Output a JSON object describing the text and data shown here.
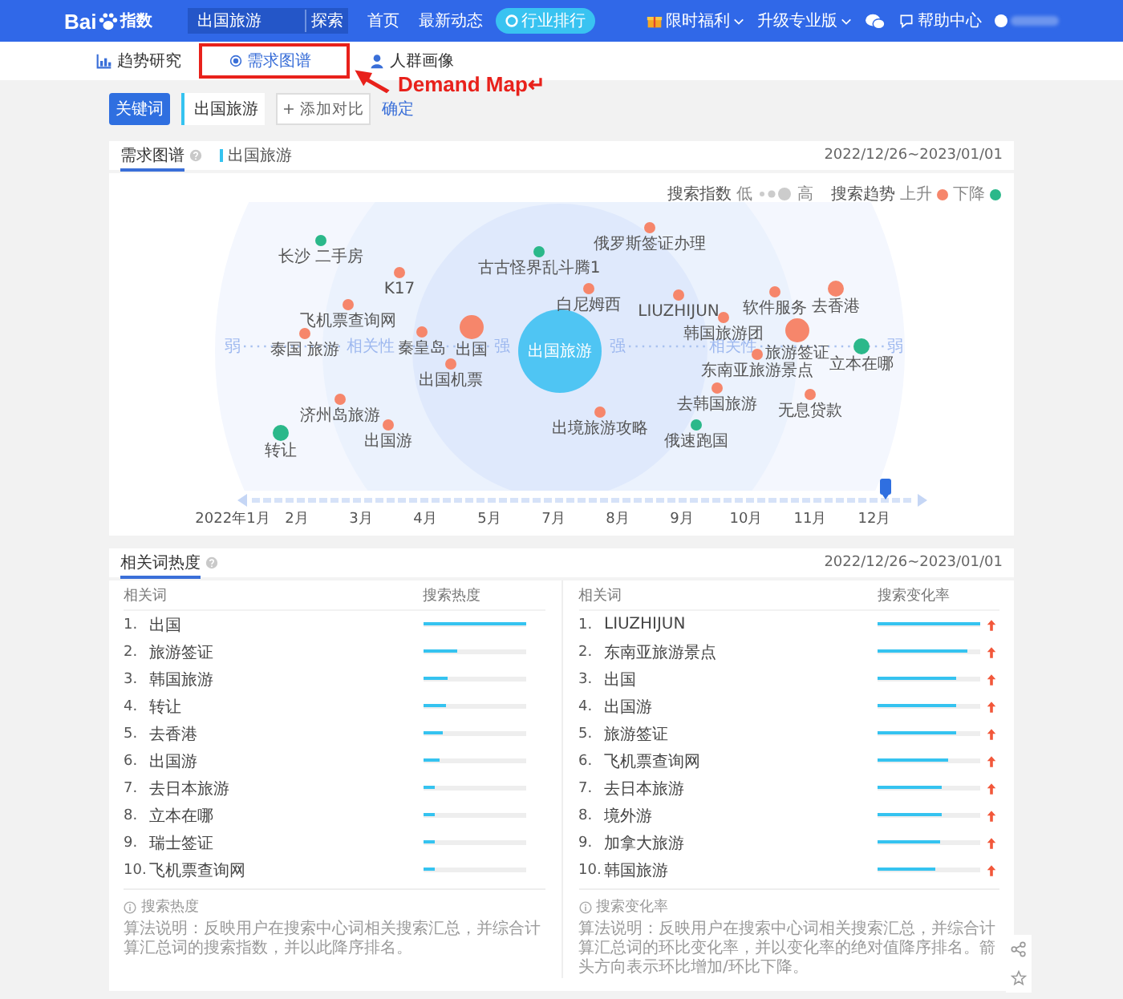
{
  "top_bar": {
    "logo": {
      "latin": "Bai",
      "chinese": "指数"
    },
    "search": {
      "value": "出国旅游",
      "button": "探索"
    },
    "nav": [
      "首页",
      "最新动态"
    ],
    "ranking_button": "行业排行",
    "menus": [
      "限时福利",
      "升级专业版"
    ],
    "help": "帮助中心"
  },
  "sub_nav": [
    {
      "label": "趋势研究",
      "kind": "chart",
      "selected": false
    },
    {
      "label": "需求图谱",
      "kind": "radio",
      "selected": true
    },
    {
      "label": "人群画像",
      "kind": "person",
      "selected": false
    }
  ],
  "annotation": {
    "text": "Demand Map↵"
  },
  "query_bar": {
    "keyword_button": "关键词",
    "keyword": "出国旅游",
    "add_compare": "+ 添加对比",
    "confirm": "确定"
  },
  "demand_map": {
    "tab": "需求图谱",
    "series": "出国旅游",
    "date_range": "2022/12/26~2023/01/01",
    "legend": {
      "index_label": "搜索指数",
      "low": "低",
      "high": "高",
      "trend_label": "搜索趋势",
      "up": "上升",
      "down": "下降"
    },
    "center": "出国旅游",
    "axis_left": [
      "弱",
      "相关性",
      "强"
    ],
    "axis_right": [
      "强",
      "相关性",
      "弱"
    ],
    "nodes": [
      {
        "label": "长沙 二手房",
        "color": "#2bb88a",
        "kind": "small"
      },
      {
        "label": "K17",
        "color": "#f6866b",
        "kind": "small"
      },
      {
        "label": "飞机票查询网",
        "color": "#f6866b",
        "kind": "small"
      },
      {
        "label": "泰国 旅游",
        "color": "#f6866b",
        "kind": "small"
      },
      {
        "label": "秦皇岛",
        "color": "#f6866b",
        "kind": "small"
      },
      {
        "label": "出国",
        "color": "#f6866b",
        "kind": "large"
      },
      {
        "label": "出国机票",
        "color": "#f6866b",
        "kind": "small"
      },
      {
        "label": "济州岛旅游",
        "color": "#f6866b",
        "kind": "small"
      },
      {
        "label": "出国游",
        "color": "#f6866b",
        "kind": "small"
      },
      {
        "label": "转让",
        "color": "#2bb88a",
        "kind": "medium"
      },
      {
        "label": "古古怪界乱斗腾1",
        "color": "#2bb88a",
        "kind": "small"
      },
      {
        "label": "俄罗斯签证办理",
        "color": "#f6866b",
        "kind": "small"
      },
      {
        "label": "白尼姆西",
        "color": "#f6866b",
        "kind": "small"
      },
      {
        "label": "LIUZHIJUN",
        "color": "#f6866b",
        "kind": "small"
      },
      {
        "label": "韩国旅游团",
        "color": "#f6866b",
        "kind": "small"
      },
      {
        "label": "软件服务",
        "color": "#f6866b",
        "kind": "small"
      },
      {
        "label": "去香港",
        "color": "#f6866b",
        "kind": "medium"
      },
      {
        "label": "旅游签证",
        "color": "#f6866b",
        "kind": "large"
      },
      {
        "label": "立本在哪",
        "color": "#2bb88a",
        "kind": "medium"
      },
      {
        "label": "东南亚旅游景点",
        "color": "#f6866b",
        "kind": "small"
      },
      {
        "label": "去韩国旅游",
        "color": "#f6866b",
        "kind": "small"
      },
      {
        "label": "无息贷款",
        "color": "#f6866b",
        "kind": "small"
      },
      {
        "label": "出境旅游攻略",
        "color": "#f6866b",
        "kind": "small"
      },
      {
        "label": "俄速跑国",
        "color": "#2bb88a",
        "kind": "small"
      }
    ],
    "months": [
      "2022年1月",
      "2月",
      "3月",
      "4月",
      "5月",
      "7月",
      "8月",
      "9月",
      "10月",
      "11月",
      "12月"
    ]
  },
  "related_heat": {
    "title": "相关词热度",
    "date_range": "2022/12/26~2023/01/01",
    "left": {
      "columns": [
        "相关词",
        "搜索热度"
      ],
      "rows": [
        {
          "rank": "1.",
          "word": "出国",
          "level": 1.0
        },
        {
          "rank": "2.",
          "word": "旅游签证",
          "level": 0.33
        },
        {
          "rank": "3.",
          "word": "韩国旅游",
          "level": 0.24
        },
        {
          "rank": "4.",
          "word": "转让",
          "level": 0.22
        },
        {
          "rank": "5.",
          "word": "去香港",
          "level": 0.19
        },
        {
          "rank": "6.",
          "word": "出国游",
          "level": 0.16
        },
        {
          "rank": "7.",
          "word": "去日本旅游",
          "level": 0.12
        },
        {
          "rank": "8.",
          "word": "立本在哪",
          "level": 0.11
        },
        {
          "rank": "9.",
          "word": "瑞士签证",
          "level": 0.11
        },
        {
          "rank": "10.",
          "word": "飞机票查询网",
          "level": 0.11
        }
      ],
      "note_title": "搜索热度",
      "note": "算法说明：反映用户在搜索中心词相关搜索汇总，并综合计算汇总词的搜索指数，并以此降序排名。"
    },
    "right": {
      "columns": [
        "相关词",
        "搜索变化率"
      ],
      "rows": [
        {
          "rank": "1.",
          "word": "LIUZHIJUN",
          "level": 1.0,
          "rising": true
        },
        {
          "rank": "2.",
          "word": "东南亚旅游景点",
          "level": 0.88,
          "rising": true
        },
        {
          "rank": "3.",
          "word": "出国",
          "level": 0.77,
          "rising": true
        },
        {
          "rank": "4.",
          "word": "出国游",
          "level": 0.77,
          "rising": true
        },
        {
          "rank": "5.",
          "word": "旅游签证",
          "level": 0.76,
          "rising": true
        },
        {
          "rank": "6.",
          "word": "飞机票查询网",
          "level": 0.68,
          "rising": true
        },
        {
          "rank": "7.",
          "word": "去日本旅游",
          "level": 0.62,
          "rising": true
        },
        {
          "rank": "8.",
          "word": "境外游",
          "level": 0.62,
          "rising": true
        },
        {
          "rank": "9.",
          "word": "加拿大旅游",
          "level": 0.61,
          "rising": true
        },
        {
          "rank": "10.",
          "word": "韩国旅游",
          "level": 0.56,
          "rising": true
        }
      ],
      "note_title": "搜索变化率",
      "note": "算法说明：反映用户在搜索中心词相关搜索汇总，并综合计算汇总词的环比变化率，并以变化率的绝对值降序排名。箭头方向表示环比增加/环比下降。"
    }
  }
}
